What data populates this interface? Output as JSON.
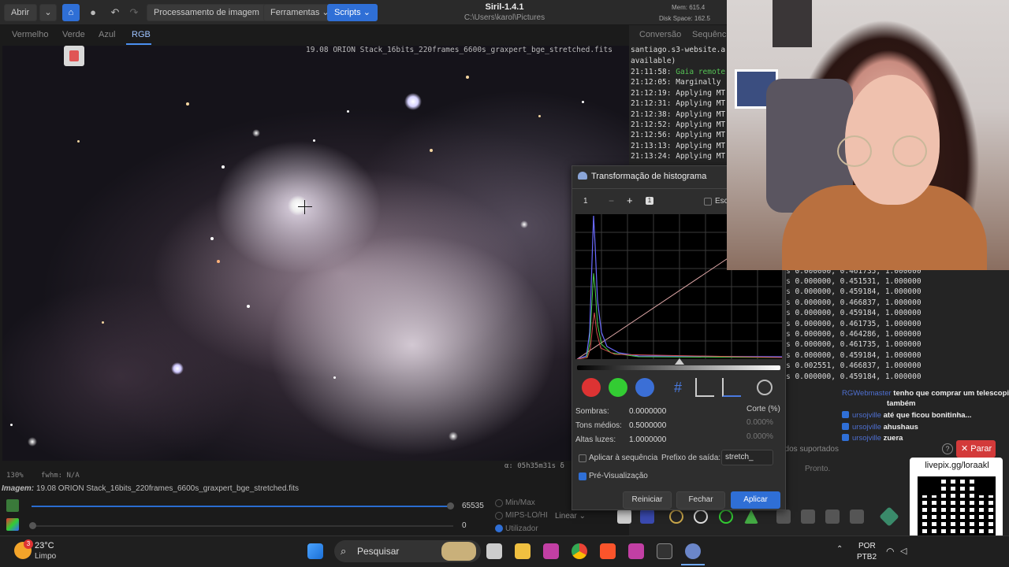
{
  "toolbar": {
    "open_label": "Abrir",
    "image_processing_label": "Processamento de imagem",
    "tools_label": "Ferramentas",
    "scripts_label": "Scripts"
  },
  "app": {
    "title": "Siril-1.4.1",
    "path": "C:\\Users\\karol\\Pictures",
    "mem": "Mem: 615.4",
    "disk": "Disk Space: 162.5"
  },
  "channels": [
    "Vermelho",
    "Verde",
    "Azul",
    "RGB"
  ],
  "right_tabs": [
    "Conversão",
    "Sequência"
  ],
  "image": {
    "filename": "19.08 ORION Stack_16bits_220frames_6600s_graxpert_bge_stretched.fits",
    "zoom": "130%",
    "fwhm": "fwhm: N/A",
    "coords": "α: 05h35m31s  δ"
  },
  "image_label": {
    "prefix": "Imagem:",
    "name": "19.08 ORION Stack_16bits_220frames_6600s_graxpert_bge_stretched.fits"
  },
  "display": {
    "max_value": "65535",
    "min_value": "0",
    "modes": [
      "Min/Max",
      "MIPS-LO/HI",
      "Utilizador"
    ],
    "scale": "Linear"
  },
  "console_log": [
    {
      "time": "santiago.s3-website.a",
      "text": ""
    },
    {
      "time": "available)",
      "text": ""
    },
    {
      "time": "21:11:58:",
      "text": "Gaia remote",
      "green": true
    },
    {
      "time": "21:12:05:",
      "text": "Marginally"
    },
    {
      "time": "21:12:19:",
      "text": "Applying MT"
    },
    {
      "time": "21:12:31:",
      "text": "Applying MT"
    },
    {
      "time": "21:12:38:",
      "text": "Applying MT"
    },
    {
      "time": "21:12:52:",
      "text": "Applying MT"
    },
    {
      "time": "21:12:56:",
      "text": "Applying MT"
    },
    {
      "time": "21:13:13:",
      "text": "Applying MT"
    },
    {
      "time": "21:13:24:",
      "text": "Applying MT"
    }
  ],
  "console_values": [
    "s 0.000000, 0.461735, 1.000000",
    "s 0.000000, 0.451531, 1.000000",
    "s 0.000000, 0.459184, 1.000000",
    "s 0.000000, 0.466837, 1.000000",
    "s 0.000000, 0.459184, 1.000000",
    "s 0.000000, 0.461735, 1.000000",
    "s 0.000000, 0.464286, 1.000000",
    "s 0.000000, 0.461735, 1.000000",
    "s 0.000000, 0.459184, 1.000000",
    "s 0.002551, 0.466837, 1.000000",
    "s 0.000000, 0.459184, 1.000000"
  ],
  "console_footer": {
    "supported": "ndos suportados",
    "stop_label": "Parar",
    "ready": "Pronto."
  },
  "histogram_dialog": {
    "title": "Transformação de histograma",
    "zoom_value": "1",
    "zoom_minus": "−",
    "zoom_plus": "+",
    "scale_label": "Esca",
    "shadows_label": "Sombras:",
    "shadows_value": "0.0000000",
    "midtones_label": "Tons médios:",
    "midtones_value": "0.5000000",
    "highlights_label": "Altas luzes:",
    "highlights_value": "1.0000000",
    "clip_label": "Corte (%)",
    "clip_low": "0.000%",
    "clip_high": "0.000%",
    "apply_sequence_label": "Aplicar à sequência",
    "output_prefix_label": "Prefixo de saída:",
    "output_prefix_value": "stretch_",
    "preview_label": "Pré-Visualização",
    "reset_label": "Reiniciar",
    "close_label": "Fechar",
    "apply_label": "Aplicar"
  },
  "chat": [
    {
      "user": "RGWebmaster",
      "message": "tenho que comprar um telescopio"
    },
    {
      "user": "",
      "message": "também"
    },
    {
      "user": "ursojville",
      "message": "até que ficou bonitinha..."
    },
    {
      "user": "ursojville",
      "message": "ahushaus"
    },
    {
      "user": "ursojville",
      "message": "zuera"
    }
  ],
  "qr": {
    "text": "livepix.gg/loraakl"
  },
  "taskbar": {
    "temperature": "23°C",
    "weather": "Limpo",
    "badge": "3",
    "search_placeholder": "Pesquisar",
    "lang_line1": "POR",
    "lang_line2": "PTB2"
  },
  "colors": {
    "accent": "#2f6fd6",
    "stop_button": "#d33a3a",
    "green_log": "#55c155"
  }
}
